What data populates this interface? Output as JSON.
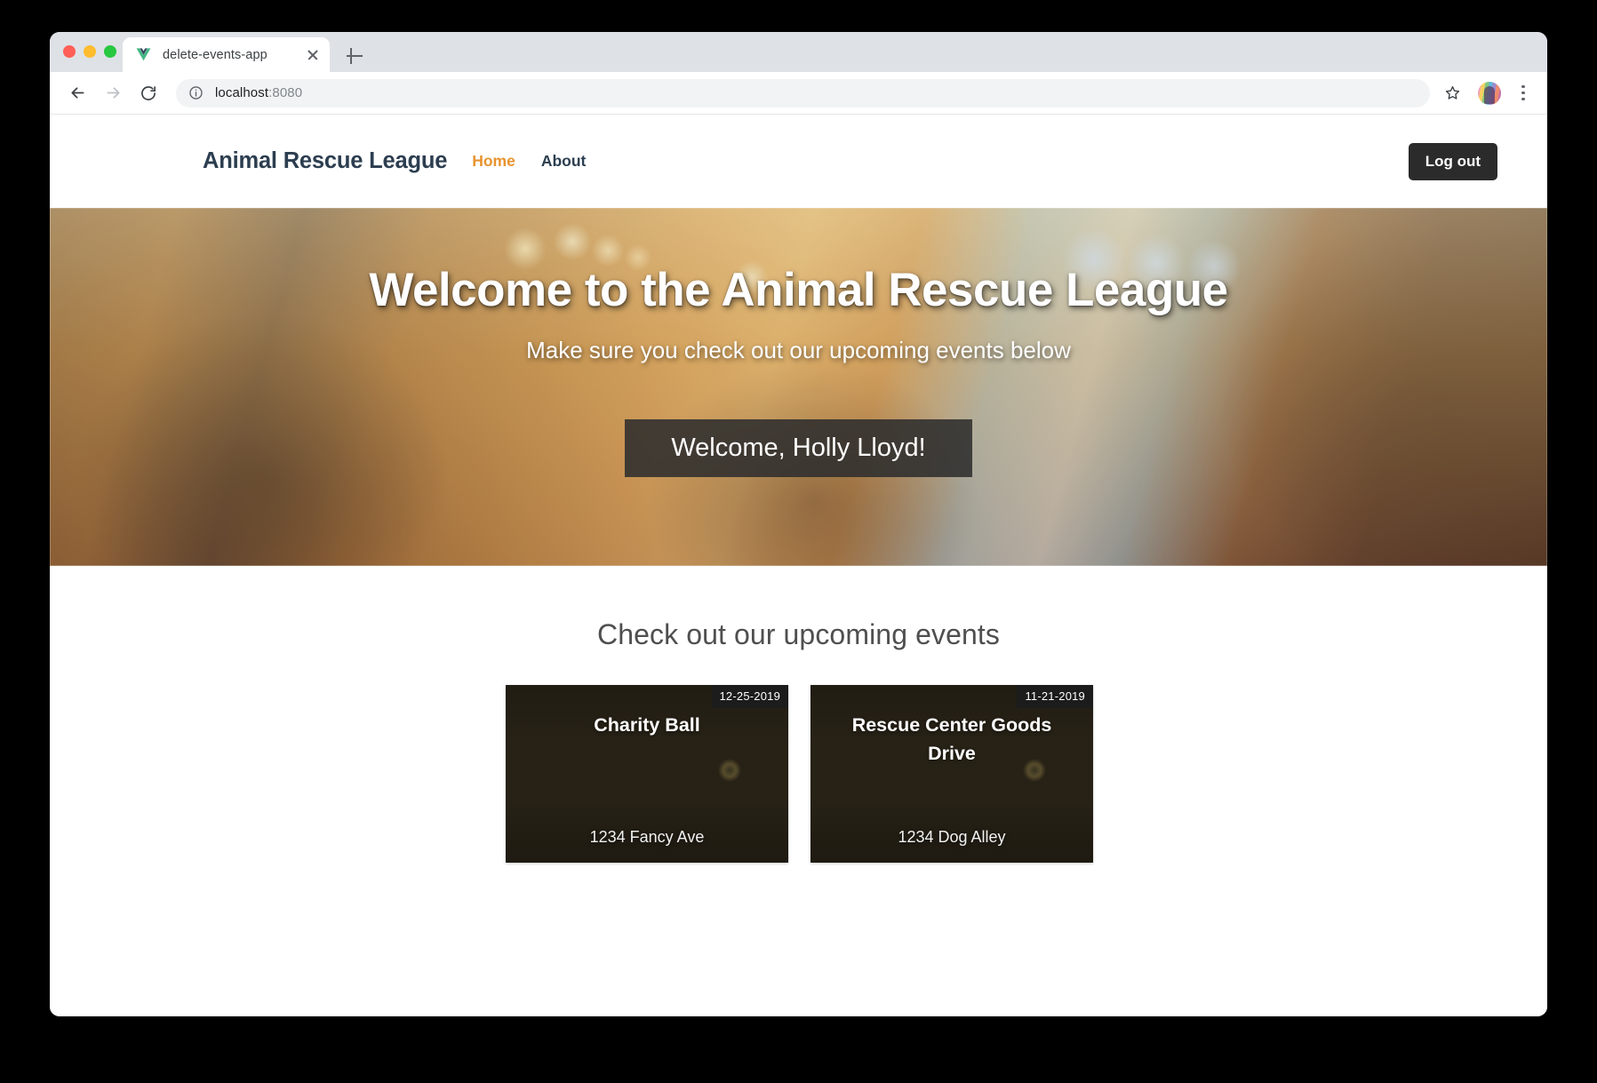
{
  "browser": {
    "tab": {
      "title": "delete-events-app",
      "favicon": "vue-logo-icon",
      "close_label": ""
    },
    "new_tab_label": "",
    "toolbar": {
      "back_icon": "arrow-left-icon",
      "forward_icon": "arrow-right-icon",
      "reload_icon": "reload-icon",
      "info_icon": "info-circle-icon",
      "url_host": "localhost",
      "url_port": ":8080",
      "url_full": "localhost:8080",
      "bookmark_icon": "star-icon",
      "profile_icon": "profile-avatar",
      "menu_icon": "three-dots-menu-icon"
    }
  },
  "site": {
    "navbar": {
      "logo": "Animal Rescue League",
      "links": [
        {
          "label": "Home",
          "active": true
        },
        {
          "label": "About",
          "active": false
        }
      ],
      "logout_label": "Log out"
    },
    "hero": {
      "title": "Welcome to the Animal Rescue League",
      "subtitle": "Make sure you check out our upcoming events below",
      "welcome_banner": "Welcome, Holly Lloyd!"
    },
    "events": {
      "heading": "Check out our upcoming events",
      "cards": [
        {
          "date": "12-25-2019",
          "title": "Charity Ball",
          "address": "1234 Fancy Ave",
          "photo": "kitten-photo"
        },
        {
          "date": "11-21-2019",
          "title": "Rescue Center Goods Drive",
          "address": "1234 Dog Alley",
          "photo": "kitten-photo"
        }
      ]
    }
  },
  "colors": {
    "accent_orange": "#e8932e",
    "navy": "#2c3e50",
    "button_dark": "#2b2b2b",
    "banner_dark": "rgba(45,45,45,0.88)",
    "badge_dark": "#1c1c1c",
    "heading_gray": "#4f4f4f"
  }
}
